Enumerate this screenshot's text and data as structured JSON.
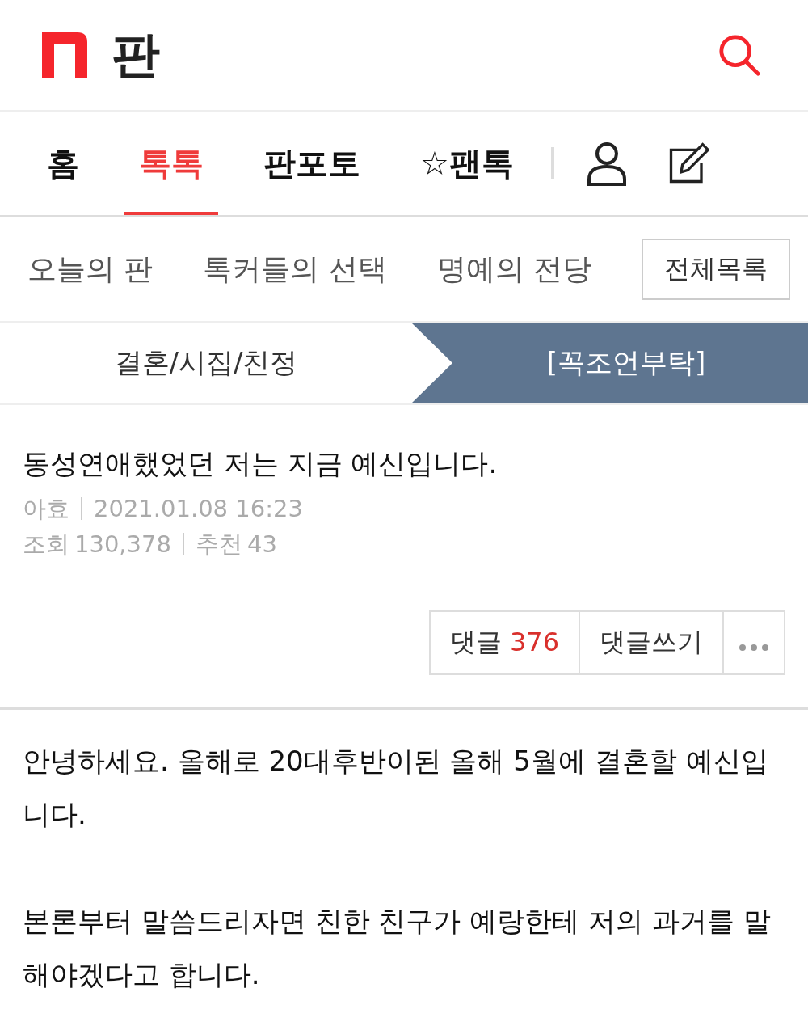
{
  "header": {
    "logo": "판"
  },
  "nav": {
    "tabs": [
      {
        "label": "홈",
        "selected": false
      },
      {
        "label": "톡톡",
        "selected": true
      },
      {
        "label": "판포토",
        "selected": false
      },
      {
        "label": "☆팬톡",
        "selected": false
      }
    ]
  },
  "submenu": {
    "items": [
      "오늘의 판",
      "톡커들의 선택",
      "명예의 전당"
    ],
    "button": "전체목록"
  },
  "breadcrumb": {
    "category": "결혼/시집/친정",
    "subcategory": "[꼭조언부탁]"
  },
  "post": {
    "title": "동성연애했었던 저는 지금 예신입니다.",
    "author": "아효",
    "date": "2021.01.08 16:23",
    "views_label": "조회",
    "views": "130,378",
    "likes_label": "추천",
    "likes": "43"
  },
  "actions": {
    "comments_label": "댓글",
    "comments_count": "376",
    "write": "댓글쓰기"
  },
  "body": [
    "안녕하세요. 올해로 20대후반이된 올해 5월에 결혼할 예신입니다.",
    "본론부터 말씀드리자면 친한 친구가 예랑한테 저의 과거를 말해야겠다고 합니다."
  ]
}
